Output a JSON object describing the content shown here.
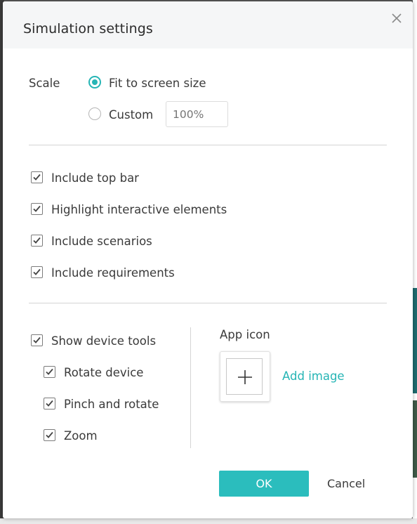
{
  "dialog": {
    "title": "Simulation settings"
  },
  "scale": {
    "label": "Scale",
    "options": [
      {
        "label": "Fit to screen size",
        "checked": true
      },
      {
        "label": "Custom",
        "checked": false
      }
    ],
    "custom_placeholder": "100%"
  },
  "display_options": [
    {
      "label": "Include top bar",
      "checked": true
    },
    {
      "label": "Highlight interactive elements",
      "checked": true
    },
    {
      "label": "Include scenarios",
      "checked": true
    },
    {
      "label": "Include requirements",
      "checked": true
    }
  ],
  "device_tools": {
    "label": "Show device tools",
    "checked": true,
    "sub_options": [
      {
        "label": "Rotate device",
        "checked": true
      },
      {
        "label": "Pinch and rotate",
        "checked": true
      },
      {
        "label": "Zoom",
        "checked": true
      }
    ]
  },
  "app_icon": {
    "label": "App icon",
    "add_label": "Add image"
  },
  "buttons": {
    "ok": "OK",
    "cancel": "Cancel"
  },
  "colors": {
    "accent": "#2bbdbd",
    "header_bg": "#f5f6f7"
  }
}
